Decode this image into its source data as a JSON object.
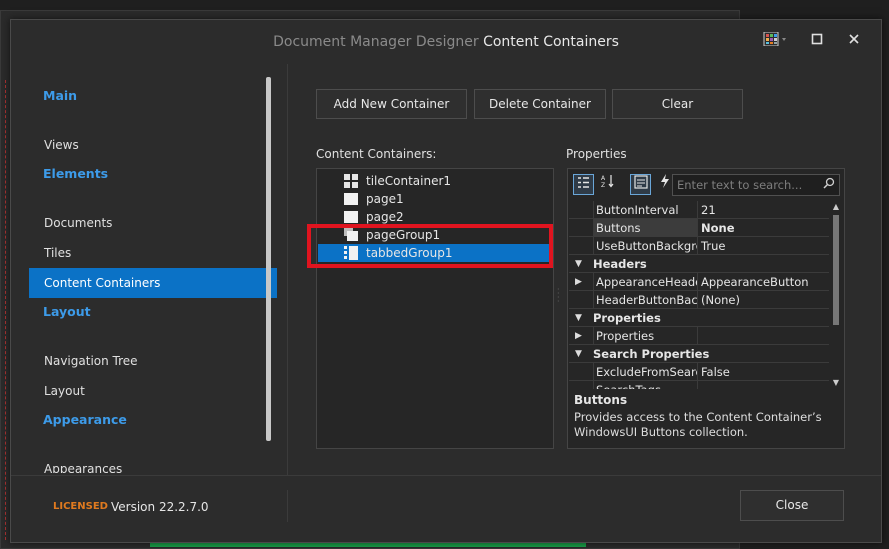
{
  "window": {
    "title_prefix": "Document Manager Designer",
    "title_main": "Content Containers",
    "controls": [
      "palette-icon",
      "maximize-icon",
      "close-icon"
    ]
  },
  "nav": {
    "groups": [
      {
        "title": "Main",
        "items": [
          "Views"
        ]
      },
      {
        "title": "Elements",
        "items": [
          "Documents",
          "Tiles",
          "Content Containers"
        ]
      },
      {
        "title": "Layout",
        "items": [
          "Navigation Tree",
          "Layout"
        ]
      },
      {
        "title": "Appearance",
        "items": [
          "Appearances"
        ]
      }
    ],
    "selected": "Content Containers"
  },
  "toolbar": {
    "add_label": "Add New Container",
    "delete_label": "Delete Container",
    "clear_label": "Clear"
  },
  "containers": {
    "label": "Content Containers:",
    "items": [
      {
        "name": "tileContainer1",
        "icon": "tile-container-icon"
      },
      {
        "name": "page1",
        "icon": "page-icon"
      },
      {
        "name": "page2",
        "icon": "page-icon"
      },
      {
        "name": "pageGroup1",
        "icon": "page-group-icon"
      },
      {
        "name": "tabbedGroup1",
        "icon": "tabbed-group-icon"
      }
    ],
    "selected": "tabbedGroup1"
  },
  "properties": {
    "label": "Properties",
    "search_placeholder": "Enter text to search...",
    "rows": [
      {
        "type": "prop",
        "name": "ButtonInterval",
        "value": "21"
      },
      {
        "type": "prop",
        "name": "Buttons",
        "value": "None",
        "bold": true,
        "selected": true
      },
      {
        "type": "prop",
        "name": "UseButtonBackgrou",
        "value": "True"
      },
      {
        "type": "cat",
        "name": "Headers"
      },
      {
        "type": "prop",
        "name": "AppearanceHeader",
        "value": "AppearanceButton",
        "expandable": true
      },
      {
        "type": "prop",
        "name": "HeaderButtonBack",
        "value": "(None)"
      },
      {
        "type": "cat",
        "name": "Properties"
      },
      {
        "type": "prop",
        "name": "Properties",
        "value": "",
        "expandable": true
      },
      {
        "type": "cat",
        "name": "Search Properties"
      },
      {
        "type": "prop",
        "name": "ExcludeFromSearch",
        "value": "False"
      },
      {
        "type": "prop",
        "name": "SearchTags",
        "value": ""
      }
    ],
    "desc_title": "Buttons",
    "desc_text": "Provides access to the Content Container’s WindowsUI Buttons collection."
  },
  "footer": {
    "licensed": "LICENSED",
    "version": "Version 22.2.7.0",
    "close_label": "Close"
  },
  "colors": {
    "accent": "#0b72c6",
    "category": "#3d9be9",
    "highlight": "#e0141f",
    "licensed": "#e07a1f"
  }
}
